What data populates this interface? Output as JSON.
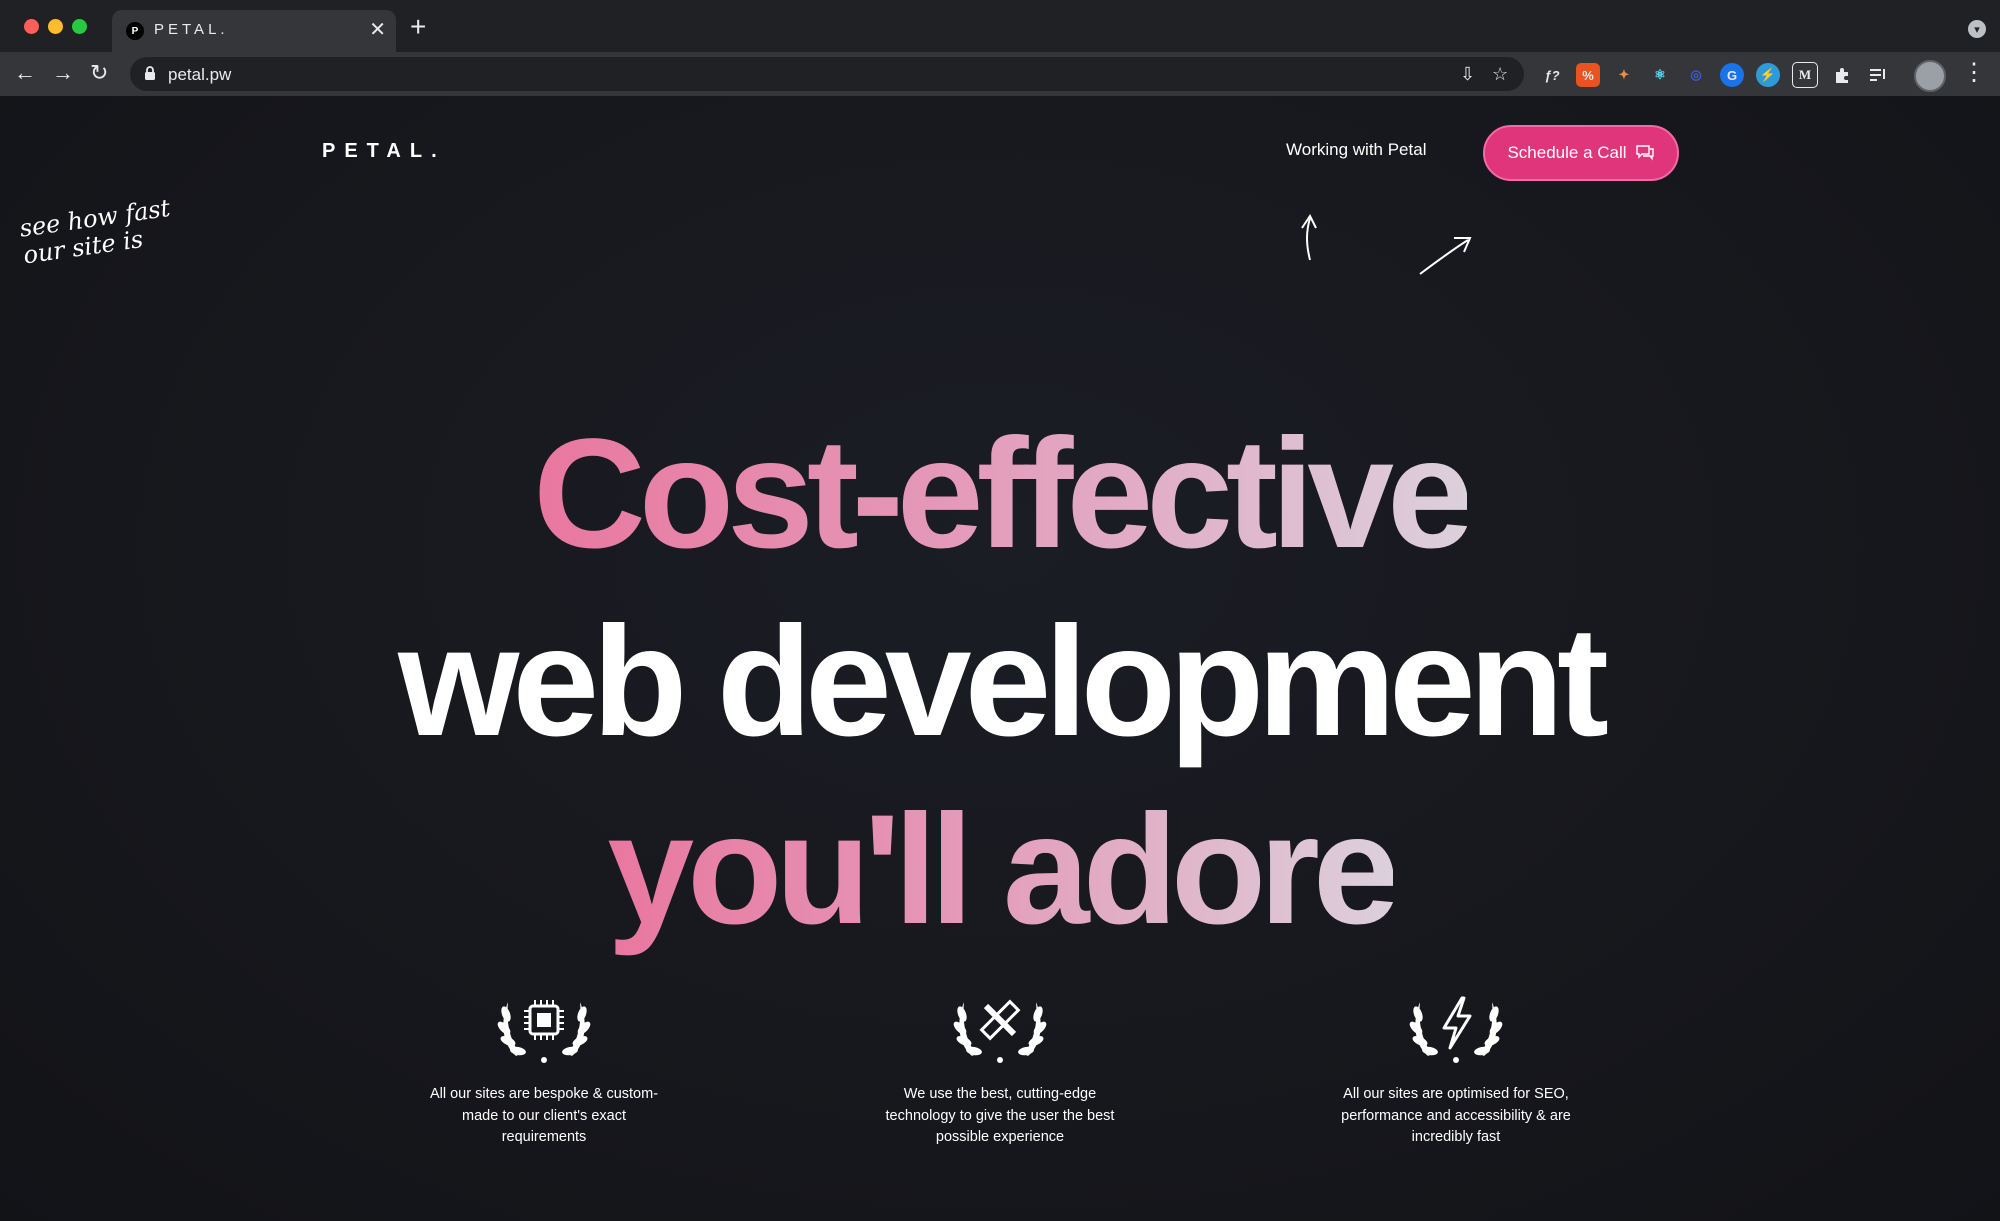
{
  "browser": {
    "tab_title": "PETAL.",
    "tab_favicon_letter": "P",
    "url": "petal.pw",
    "extensions": [
      "ƒ?",
      "%",
      "✦",
      "⚛",
      "◎",
      "G",
      "⚡",
      "M",
      "puzzle",
      "queue"
    ]
  },
  "header": {
    "logo": "PETAL.",
    "nav_link": "Working with Petal",
    "cta_label": "Schedule a Call",
    "handwritten_note": "see how fast\nour site is"
  },
  "hero": {
    "line1": "Cost-effective",
    "line2": "web development",
    "line3": "you'll adore"
  },
  "features": [
    {
      "icon": "chip-laurel-icon",
      "text": "All our sites are bespoke & custom-made to our client's exact requirements"
    },
    {
      "icon": "tools-laurel-icon",
      "text": "We use the best, cutting-edge technology to give the user the best possible experience"
    },
    {
      "icon": "lightning-laurel-icon",
      "text": "All our sites are optimised for SEO, performance and accessibility & are incredibly fast"
    }
  ],
  "colors": {
    "background": "#17181d",
    "accent": "#e0357a",
    "gradient_start": "#e9779f",
    "gradient_end": "#dcd0db"
  }
}
